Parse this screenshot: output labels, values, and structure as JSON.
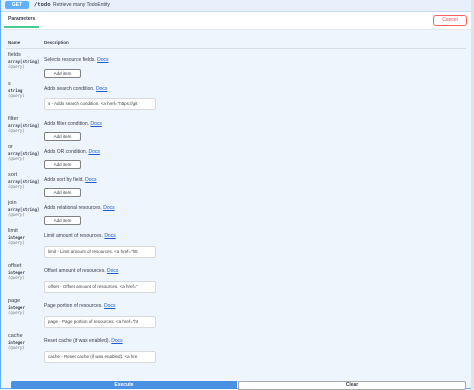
{
  "operation": {
    "method": "GET",
    "path": "/todo",
    "summary": "Retrieve many TodoEntity"
  },
  "header": {
    "tab_label": "Parameters",
    "cancel_label": "Cancel"
  },
  "columns": {
    "name": "Name",
    "description": "Description"
  },
  "params": [
    {
      "name": "fields",
      "type": "array[string]",
      "in": "(query)",
      "desc": "Selects resource fields.",
      "docs": "Docs",
      "control": "button",
      "button_label": "Add item"
    },
    {
      "name": "s",
      "type": "string",
      "in": "(query)",
      "desc": "Adds search condition.",
      "docs": "Docs",
      "control": "input",
      "value": "s - Adds search condition. <a href=\"https://git"
    },
    {
      "name": "filter",
      "type": "array[string]",
      "in": "(query)",
      "desc": "Adds filter condition.",
      "docs": "Docs",
      "control": "button",
      "button_label": "Add item"
    },
    {
      "name": "or",
      "type": "array[string]",
      "in": "(query)",
      "desc": "Adds OR condition.",
      "docs": "Docs",
      "control": "button",
      "button_label": "Add item"
    },
    {
      "name": "sort",
      "type": "array[string]",
      "in": "(query)",
      "desc": "Adds sort by field.",
      "docs": "Docs",
      "control": "button",
      "button_label": "Add item"
    },
    {
      "name": "join",
      "type": "array[string]",
      "in": "(query)",
      "desc": "Adds relational resources.",
      "docs": "Docs",
      "control": "button",
      "button_label": "Add item"
    },
    {
      "name": "limit",
      "type": "integer",
      "in": "(query)",
      "desc": "Limit amount of resources.",
      "docs": "Docs",
      "control": "input",
      "value": "limit - Limit amount of resources. <a href=\"htt"
    },
    {
      "name": "offset",
      "type": "integer",
      "in": "(query)",
      "desc": "Offset amount of resources.",
      "docs": "Docs",
      "control": "input",
      "value": "offset - Offset amount of resources. <a href=\""
    },
    {
      "name": "page",
      "type": "integer",
      "in": "(query)",
      "desc": "Page portion of resources.",
      "docs": "Docs",
      "control": "input",
      "value": "page - Page portion of resources. <a href=\"ht"
    },
    {
      "name": "cache",
      "type": "integer",
      "in": "(query)",
      "desc": "Reset cache (if was enabled).",
      "docs": "Docs",
      "control": "input",
      "value": "cache - Reset cache (if was enabled). <a hre"
    }
  ],
  "actions": {
    "execute_label": "Execute",
    "clear_label": "Clear"
  },
  "colors": {
    "accent": "#61affe",
    "execute": "#4990e2",
    "cancel": "#ff6060",
    "tab_underline": "#49cc90"
  }
}
